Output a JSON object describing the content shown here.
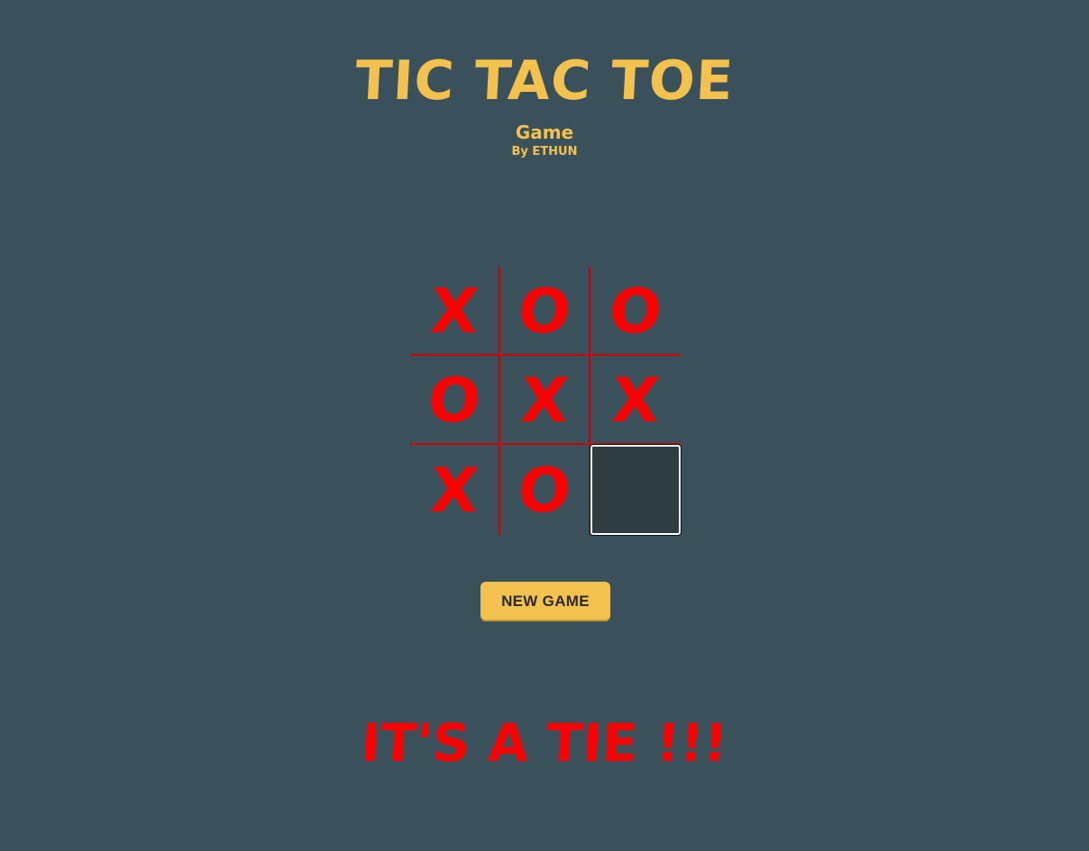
{
  "header": {
    "title": "TIC TAC TOE",
    "subtitle": "Game",
    "author": "By ETHUN"
  },
  "board": {
    "cells": [
      [
        "X",
        "O",
        "O"
      ],
      [
        "O",
        "X",
        "X"
      ],
      [
        "X",
        "O",
        ""
      ]
    ]
  },
  "controls": {
    "new_game_label": "NEW GAME"
  },
  "status": {
    "result_message": "IT'S A TIE !!!"
  },
  "colors": {
    "background": "#3a515c",
    "accent": "#f2c14e",
    "mark_color": "#ff0000",
    "grid_line": "#d00000"
  }
}
